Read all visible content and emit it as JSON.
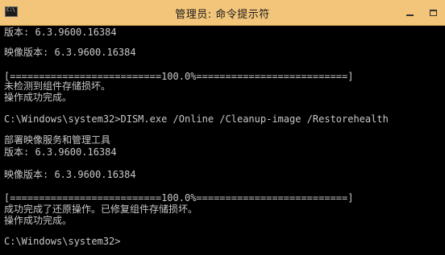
{
  "window": {
    "title": "管理员: 命令提示符",
    "icon": "console-icon",
    "icon_glyph": "C:\\",
    "controls": [
      "minimize-icon",
      "maximize-icon"
    ]
  },
  "console": {
    "text_color": "#c8c8c8",
    "background": "#000000",
    "lines": [
      "版本: 6.3.9600.16384",
      "映像版本: 6.3.9600.16384",
      "[==========================100.0%==========================]",
      "未检测到组件存储损坏。",
      "操作成功完成。",
      "C:\\Windows\\system32>DISM.exe /Online /Cleanup-image /Restorehealth",
      "部署映像服务和管理工具",
      "版本: 6.3.9600.16384",
      "映像版本: 6.3.9600.16384",
      "[==========================100.0%==========================]",
      "成功完成了还原操作。已修复组件存储损坏。",
      "操作成功完成。",
      "C:\\Windows\\system32>"
    ]
  }
}
